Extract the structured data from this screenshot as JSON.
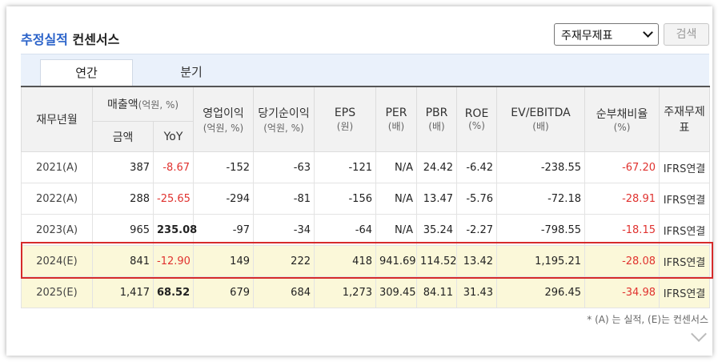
{
  "header": {
    "title_highlight": "추정실적",
    "title_rest": "컨센서스",
    "select_value": "주재무제표",
    "search_button": "검색"
  },
  "tabs": [
    {
      "label": "연간",
      "active": true
    },
    {
      "label": "분기",
      "active": false
    }
  ],
  "table": {
    "col_year": "재무년월",
    "col_sales": "매출액",
    "col_sales_unit": "(억원, %)",
    "col_sales_amount": "금액",
    "col_sales_yoy": "YoY",
    "col_op": "영업이익",
    "col_op_unit": "(억원, %)",
    "col_net": "당기순이익",
    "col_net_unit": "(억원, %)",
    "col_eps": "EPS",
    "col_eps_unit": "(원)",
    "col_per": "PER",
    "col_per_unit": "(배)",
    "col_pbr": "PBR",
    "col_pbr_unit": "(배)",
    "col_roe": "ROE",
    "col_roe_unit": "(%)",
    "col_ev": "EV/EBITDA",
    "col_ev_unit": "(배)",
    "col_debt": "순부채비율",
    "col_debt_unit": "(%)",
    "col_fs": "주재무제표",
    "rows": [
      {
        "year": "2021(A)",
        "sales": "387",
        "yoy": "-8.67",
        "op": "-152",
        "net": "-63",
        "eps": "-121",
        "per": "N/A",
        "pbr": "24.42",
        "roe": "-6.42",
        "ev": "-238.55",
        "debt": "-67.20",
        "fs": "IFRS연결"
      },
      {
        "year": "2022(A)",
        "sales": "288",
        "yoy": "-25.65",
        "op": "-294",
        "net": "-81",
        "eps": "-156",
        "per": "N/A",
        "pbr": "13.47",
        "roe": "-5.76",
        "ev": "-72.18",
        "debt": "-28.91",
        "fs": "IFRS연결"
      },
      {
        "year": "2023(A)",
        "sales": "965",
        "yoy": "235.08",
        "op": "-97",
        "net": "-34",
        "eps": "-64",
        "per": "N/A",
        "pbr": "35.24",
        "roe": "-2.27",
        "ev": "-798.55",
        "debt": "-18.15",
        "fs": "IFRS연결"
      },
      {
        "year": "2024(E)",
        "sales": "841",
        "yoy": "-12.90",
        "op": "149",
        "net": "222",
        "eps": "418",
        "per": "941.69",
        "pbr": "114.52",
        "roe": "13.42",
        "ev": "1,195.21",
        "debt": "-28.08",
        "fs": "IFRS연결"
      },
      {
        "year": "2025(E)",
        "sales": "1,417",
        "yoy": "68.52",
        "op": "679",
        "net": "684",
        "eps": "1,273",
        "per": "309.45",
        "pbr": "84.11",
        "roe": "31.43",
        "ev": "296.45",
        "debt": "-34.98",
        "fs": "IFRS연결"
      }
    ]
  },
  "footnote": "* (A) 는 실적, (E)는 컨센서스"
}
